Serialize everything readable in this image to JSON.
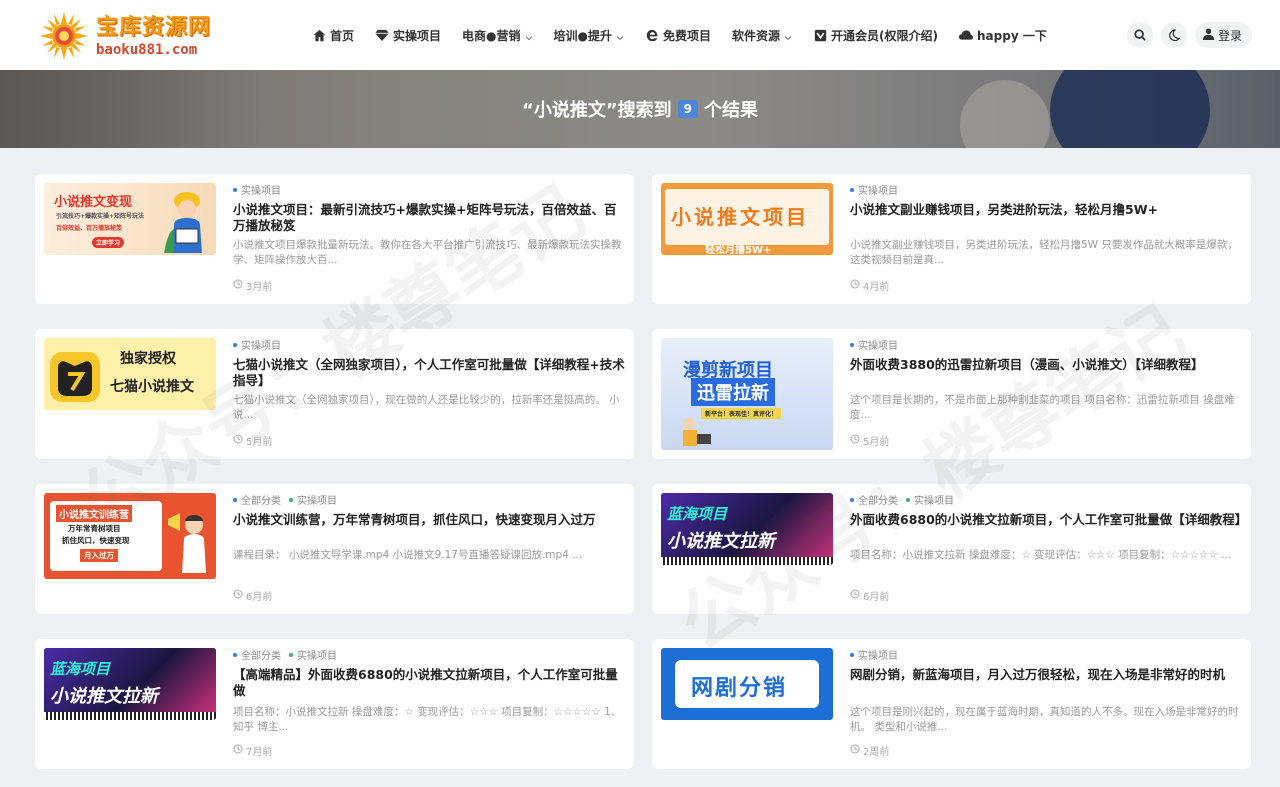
{
  "logo": {
    "title": "宝库资源网",
    "url": "baoku881.com"
  },
  "nav": {
    "items": [
      {
        "label": "首页",
        "icon": "home-icon"
      },
      {
        "label": "实操项目",
        "icon": "diamond-icon"
      },
      {
        "label": "电商●营销",
        "icon": "",
        "dropdown": true
      },
      {
        "label": "培训●提升",
        "icon": "",
        "dropdown": true
      },
      {
        "label": "免费项目",
        "icon": "edge-icon"
      },
      {
        "label": "软件资源",
        "icon": "",
        "dropdown": true
      },
      {
        "label": "开通会员(权限介绍)",
        "icon": "vip-icon"
      },
      {
        "label": "happy 一下",
        "icon": "cloud-icon"
      }
    ],
    "login_label": "登录"
  },
  "banner": {
    "prefix": "“小说推文”搜索到",
    "count": "9",
    "suffix": "个结果"
  },
  "results": [
    {
      "categories": [
        "实操项目"
      ],
      "title": "小说推文项目：最新引流技巧+爆款实操+矩阵号玩法，百倍效益、百万播放秘笈",
      "description": "小说推文项目爆款批量新玩法。教你在各大平台推广引流技巧、最新爆款玩法实操教学、矩阵操作放大百...",
      "time": "3月前",
      "thumb": {
        "line1": "小说推文变现",
        "line2": "引流技巧+爆款实操+矩阵号玩法",
        "line3": "百倍效益、百万播放秘笈",
        "button": "立即学习"
      }
    },
    {
      "categories": [
        "实操项目"
      ],
      "title": "小说推文副业赚钱项目，另类进阶玩法，轻松月撸5W+",
      "description": "小说推文副业赚钱项目，另类进阶玩法，轻松月撸5W 只要发作品就大概率是爆款，这类视频目前是真...",
      "time": "4月前",
      "thumb": {
        "line1": "小说推文项目",
        "line2": "轻松月撸5W+"
      }
    },
    {
      "categories": [
        "实操项目"
      ],
      "title": "七猫小说推文（全网独家项目），个人工作室可批量做【详细教程+技术指导】",
      "description": " 七猫小说推文（全网独家项目），现在做的人还是比较少的，拉新率还是挺高的。 小说...",
      "time": "5月前",
      "thumb": {
        "line1": "独家授权",
        "line2": "七猫小说推文"
      }
    },
    {
      "categories": [
        "实操项目"
      ],
      "title": "外面收费3880的迅雷拉新项目（漫画、小说推文）【详细教程】",
      "description": " 这个项目是长期的，不是市面上那种割韭菜的项目 项目名称：迅雷拉新项目 操盘难度...",
      "time": "5月前",
      "thumb": {
        "line1": "漫剪新项目",
        "line2": "迅雷拉新",
        "line3": "新平台！表现佳！真评化！"
      }
    },
    {
      "categories": [
        "全部分类",
        "实操项目"
      ],
      "title": "小说推文训练营，万年常青树项目，抓住风口，快速变现月入过万",
      "description": " 课程目录： 小说推文导学课.mp4 小说推文9.17号直播答疑课回放.mp4 ...",
      "time": "6月前",
      "thumb": {
        "line1": "小说推文训练营",
        "line2": "万年常青树项目",
        "line3": "抓住风口，快速变现",
        "line4": "月入过万"
      }
    },
    {
      "categories": [
        "全部分类",
        "实操项目"
      ],
      "title": "外面收费6880的小说推文拉新项目，个人工作室可批量做【详细教程】",
      "description": " 项目名称：小说推文拉新 操盘难度：☆ 变现评估：☆☆☆ 项目复制：☆☆☆☆☆ ...",
      "time": "6月前",
      "thumb": {
        "line1": "蓝海项目",
        "line2": "小说推文拉新"
      }
    },
    {
      "categories": [
        "全部分类",
        "实操项目"
      ],
      "title": "【高端精品】外面收费6880的小说推文拉新项目，个人工作室可批量做",
      "description": "项目名称：小说推文拉新 操盘难度：☆ 变现评估：☆☆☆ 项目复制：☆☆☆☆☆ 1、知乎 博主...",
      "time": "7月前",
      "thumb": {
        "line1": "蓝海项目",
        "line2": "小说推文拉新"
      }
    },
    {
      "categories": [
        "实操项目"
      ],
      "title": "网剧分销，新蓝海项目，月入过万很轻松，现在入场是非常好的时机",
      "description": "这个项目是刚兴起的，现在属于蓝海时期，真知道的人不多。现在入场是非常好的时机。 类型和小说推...",
      "time": "2周前",
      "thumb": {
        "line1": "网剧分销"
      }
    }
  ],
  "watermark": "公众号：楼尊笔记",
  "colors": {
    "accent": "#4c86d8",
    "cat_dot_primary": "#2f7fe4",
    "cat_dot_secondary": "#3bb56b"
  }
}
